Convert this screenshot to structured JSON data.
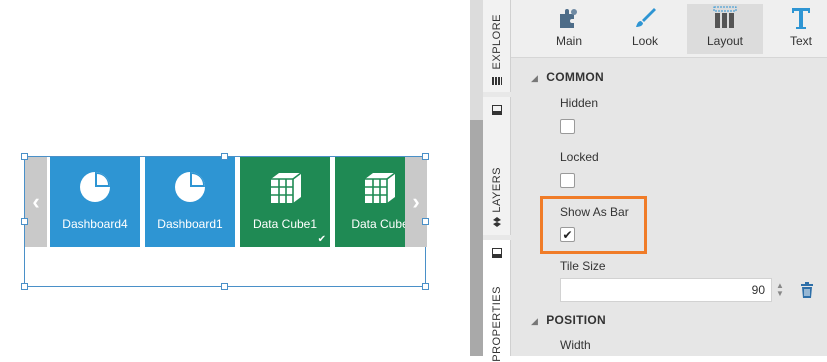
{
  "tiles": [
    {
      "label": "Dashboard4",
      "color": "#2e95d3",
      "icon": "pie-chart-icon"
    },
    {
      "label": "Dashboard1",
      "color": "#2e95d3",
      "icon": "pie-chart-icon"
    },
    {
      "label": "Data Cube1",
      "color": "#1f8a54",
      "icon": "data-cube-icon",
      "selected": true
    },
    {
      "label": "Data Cube",
      "color": "#1f8a54",
      "icon": "data-cube-icon"
    }
  ],
  "nav": {
    "left": "‹",
    "right": "›"
  },
  "side_tabs": [
    {
      "label": "EXPLORE"
    },
    {
      "label": "LAYERS"
    },
    {
      "label": "PROPERTIES"
    }
  ],
  "toolbar": [
    {
      "label": "Main",
      "icon": "puzzle-icon"
    },
    {
      "label": "Look",
      "icon": "brush-icon"
    },
    {
      "label": "Layout",
      "icon": "layout-columns-icon",
      "active": true
    },
    {
      "label": "Text",
      "icon": "text-icon"
    }
  ],
  "common": {
    "heading": "COMMON",
    "hidden_label": "Hidden",
    "hidden_checked": false,
    "locked_label": "Locked",
    "locked_checked": false,
    "show_as_bar_label": "Show As Bar",
    "show_as_bar_checked": true,
    "check_mark": "✔",
    "tile_size_label": "Tile Size",
    "tile_size_value": "90"
  },
  "position": {
    "heading": "POSITION",
    "width_label": "Width"
  },
  "colors": {
    "accent_orange": "#f07c28",
    "tile_blue": "#2e95d3",
    "tile_green": "#1f8a54",
    "selection_blue": "#4a90c8"
  }
}
